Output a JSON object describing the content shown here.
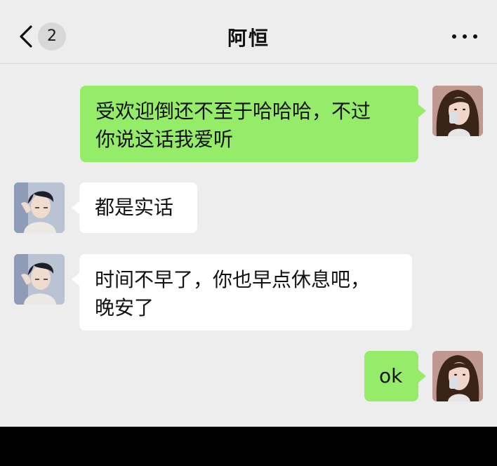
{
  "app": {
    "back_icon": "chevron-left-icon",
    "unread_badge": "2",
    "contact_name": "阿恒",
    "more_icon": "more-dots-icon"
  },
  "colors": {
    "background": "#ededed",
    "sent_bubble": "#95ec69",
    "received_bubble": "#ffffff",
    "bottom_bar": "#000000"
  },
  "messages": [
    {
      "sender": "me",
      "lines": [
        "受欢迎倒还不至于哈哈哈，不过",
        "你说这话我爱听"
      ]
    },
    {
      "sender": "contact",
      "lines": [
        "都是实话"
      ]
    },
    {
      "sender": "contact",
      "lines": [
        "时间不早了，你也早点休息吧，",
        "晚安了"
      ]
    },
    {
      "sender": "me",
      "lines": [
        "ok"
      ]
    }
  ]
}
